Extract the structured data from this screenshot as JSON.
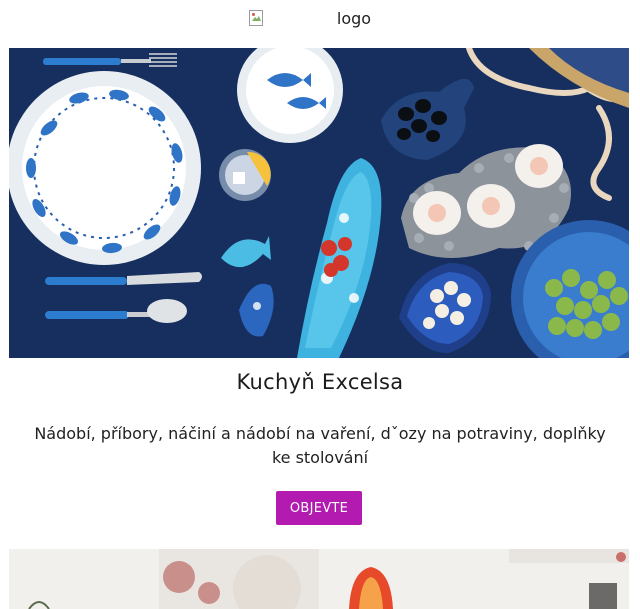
{
  "header": {
    "logo_alt": "logo"
  },
  "hero": {
    "alt": "Kuchyň Excelsa",
    "background_color": "#1a3466"
  },
  "content": {
    "title": "Kuchyň Excelsa",
    "description": "Nádobí, příbory, náčiní a nádobí na vaření, dˇozy na potraviny, doplňky ke stolování",
    "cta_label": "OBJEVTE",
    "cta_color": "#b31bb0"
  }
}
